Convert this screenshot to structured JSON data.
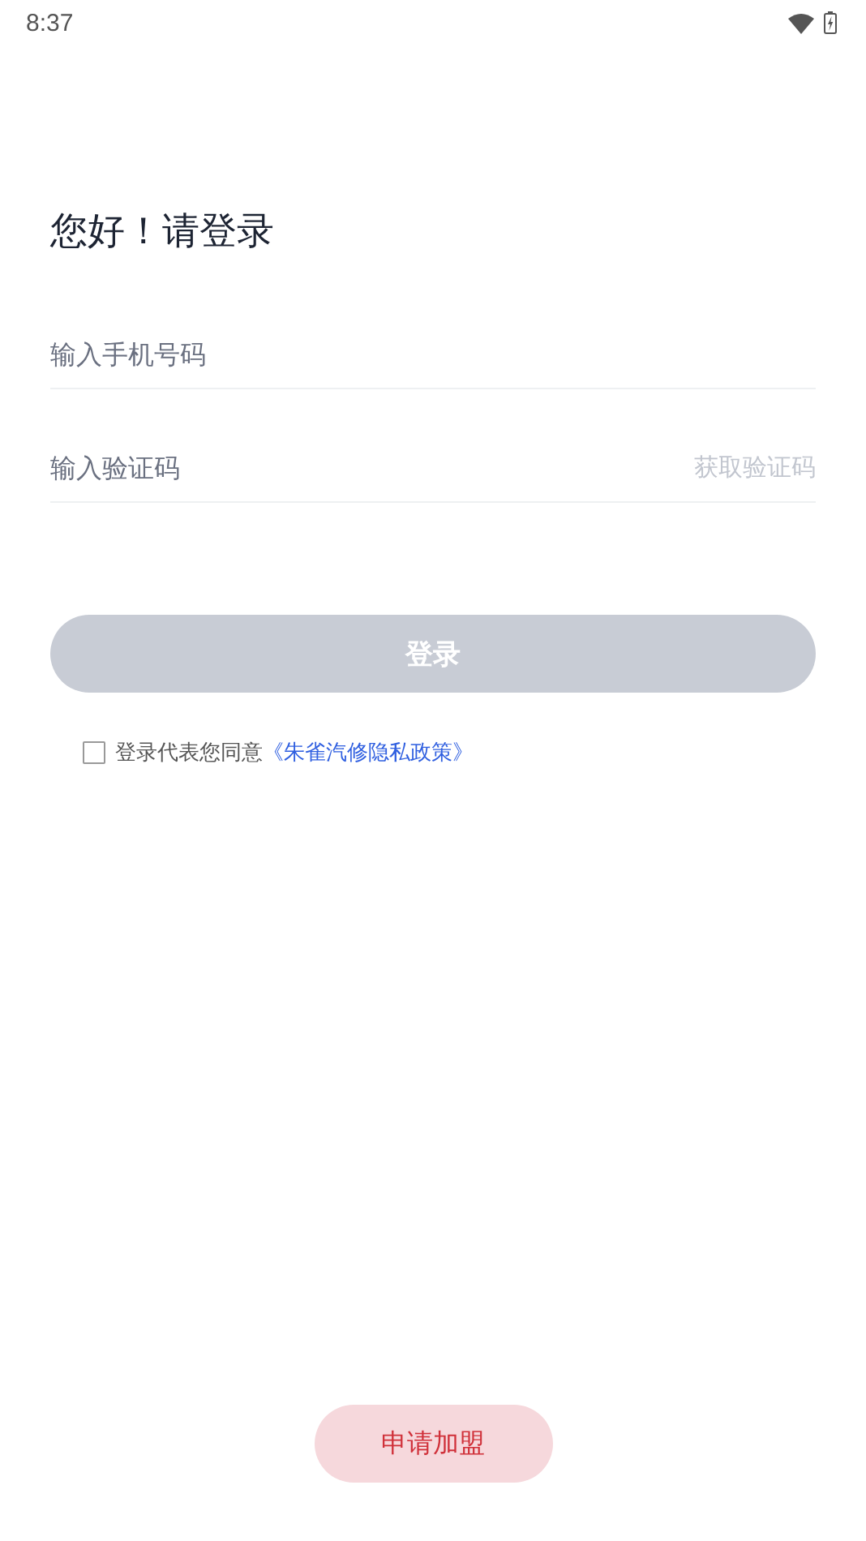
{
  "status_bar": {
    "time": "8:37"
  },
  "title": "您好！请登录",
  "phone_field": {
    "placeholder": "输入手机号码"
  },
  "code_field": {
    "placeholder": "输入验证码",
    "action": "获取验证码"
  },
  "login_button": {
    "label": "登录",
    "disabled": true
  },
  "agreement": {
    "checked": false,
    "text": "登录代表您同意",
    "link": "《朱雀汽修隐私政策》"
  },
  "join_button": {
    "label": "申请加盟"
  }
}
